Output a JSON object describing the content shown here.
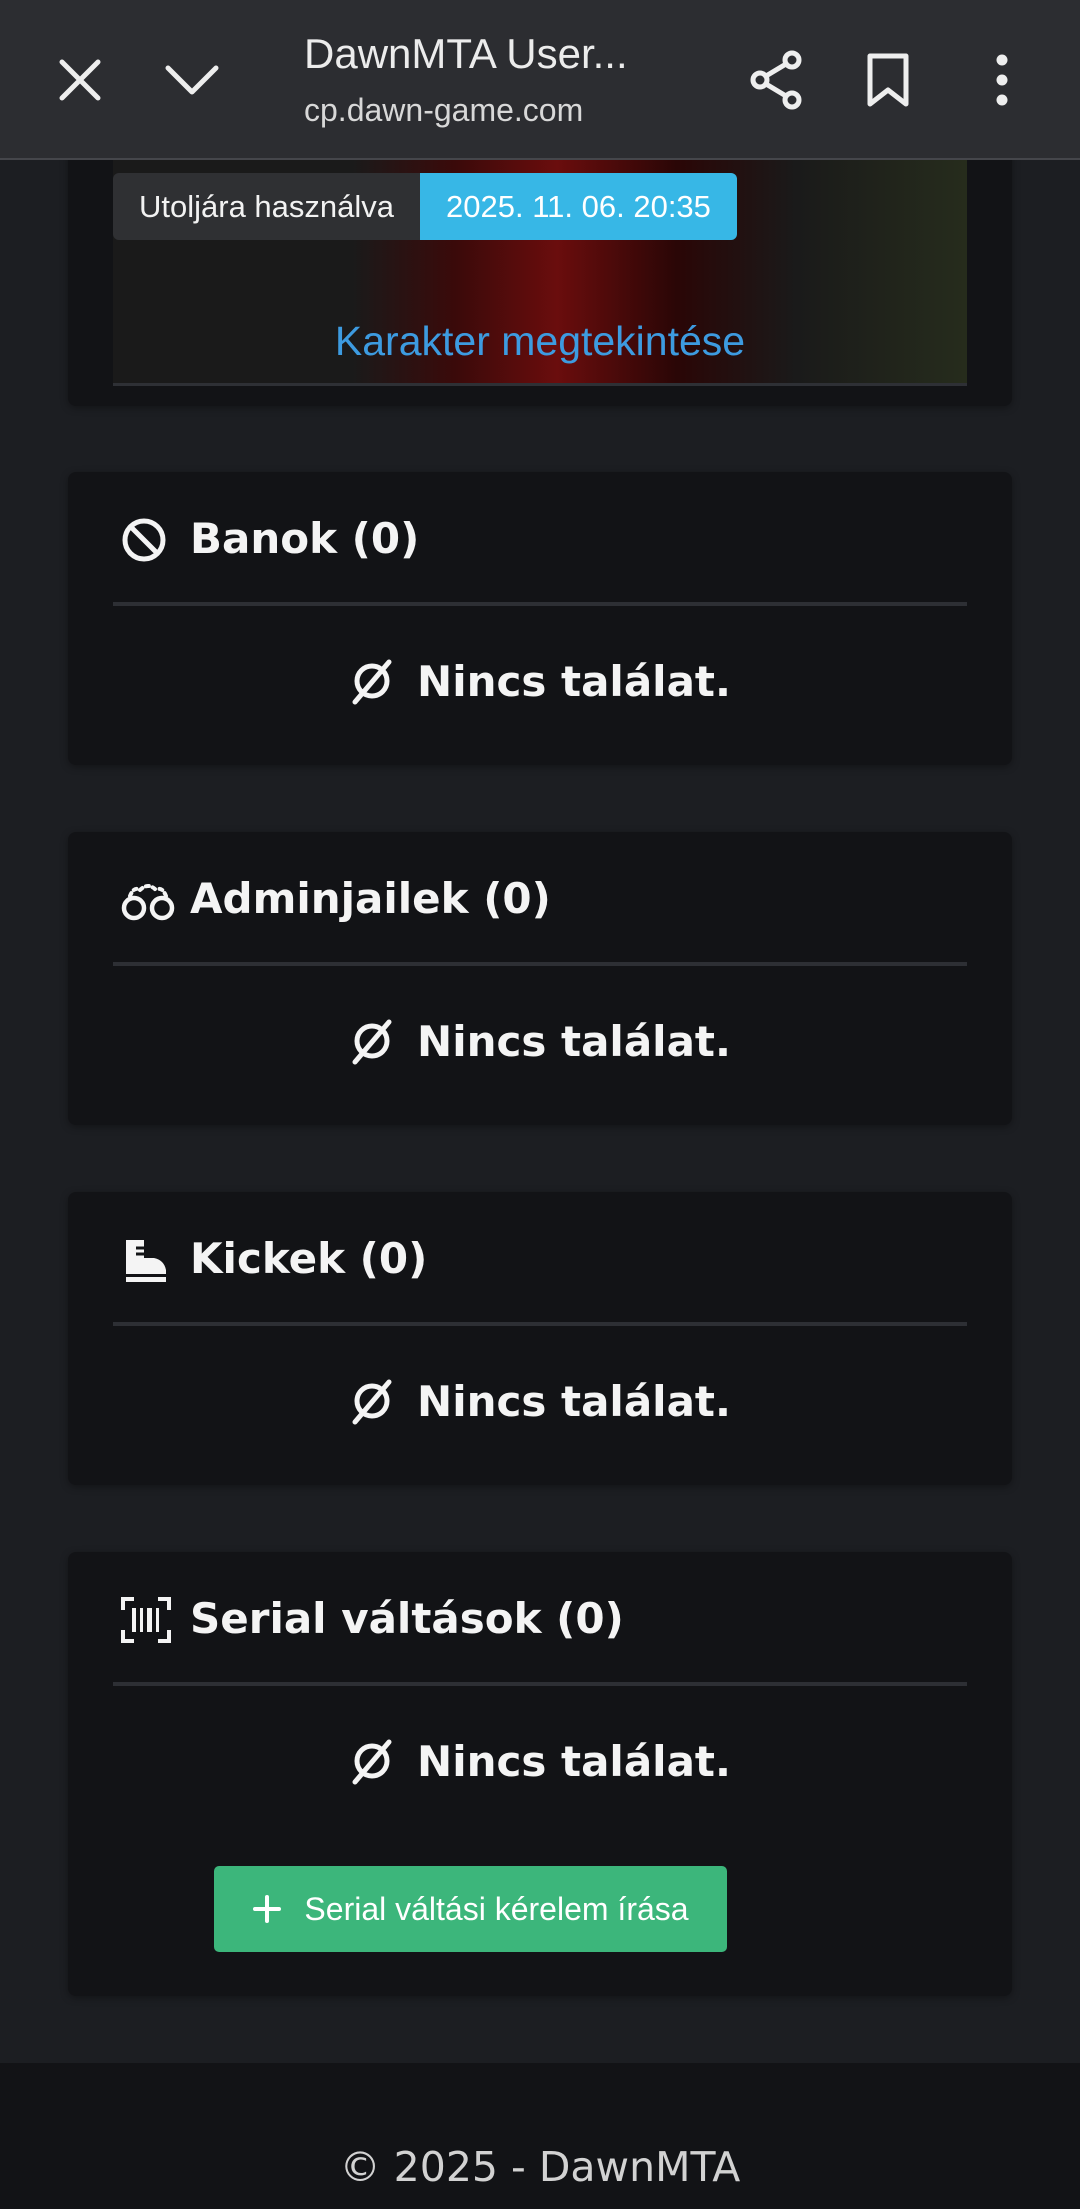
{
  "browser": {
    "title": "DawnMTA User...",
    "url": "cp.dawn-game.com"
  },
  "character": {
    "last_used_label": "Utoljára használva",
    "last_used_value": "2025. 11. 06. 20:35",
    "view_link": "Karakter megtekintése"
  },
  "sections": [
    {
      "title": "Banok (0)",
      "icon": "ban-icon",
      "empty_text": "Nincs találat."
    },
    {
      "title": "Adminjailek (0)",
      "icon": "handcuffs-icon",
      "empty_text": "Nincs találat."
    },
    {
      "title": "Kickek (0)",
      "icon": "boot-icon",
      "empty_text": "Nincs találat."
    },
    {
      "title": "Serial váltások (0)",
      "icon": "barcode-icon",
      "empty_text": "Nincs találat.",
      "button_label": "Serial váltási kérelem írása"
    }
  ],
  "footer": {
    "text": "© 2025 - DawnMTA"
  },
  "colors": {
    "accent_blue": "#37b7e6",
    "link_blue": "#3d9be0",
    "button_green": "#3cb67b"
  }
}
